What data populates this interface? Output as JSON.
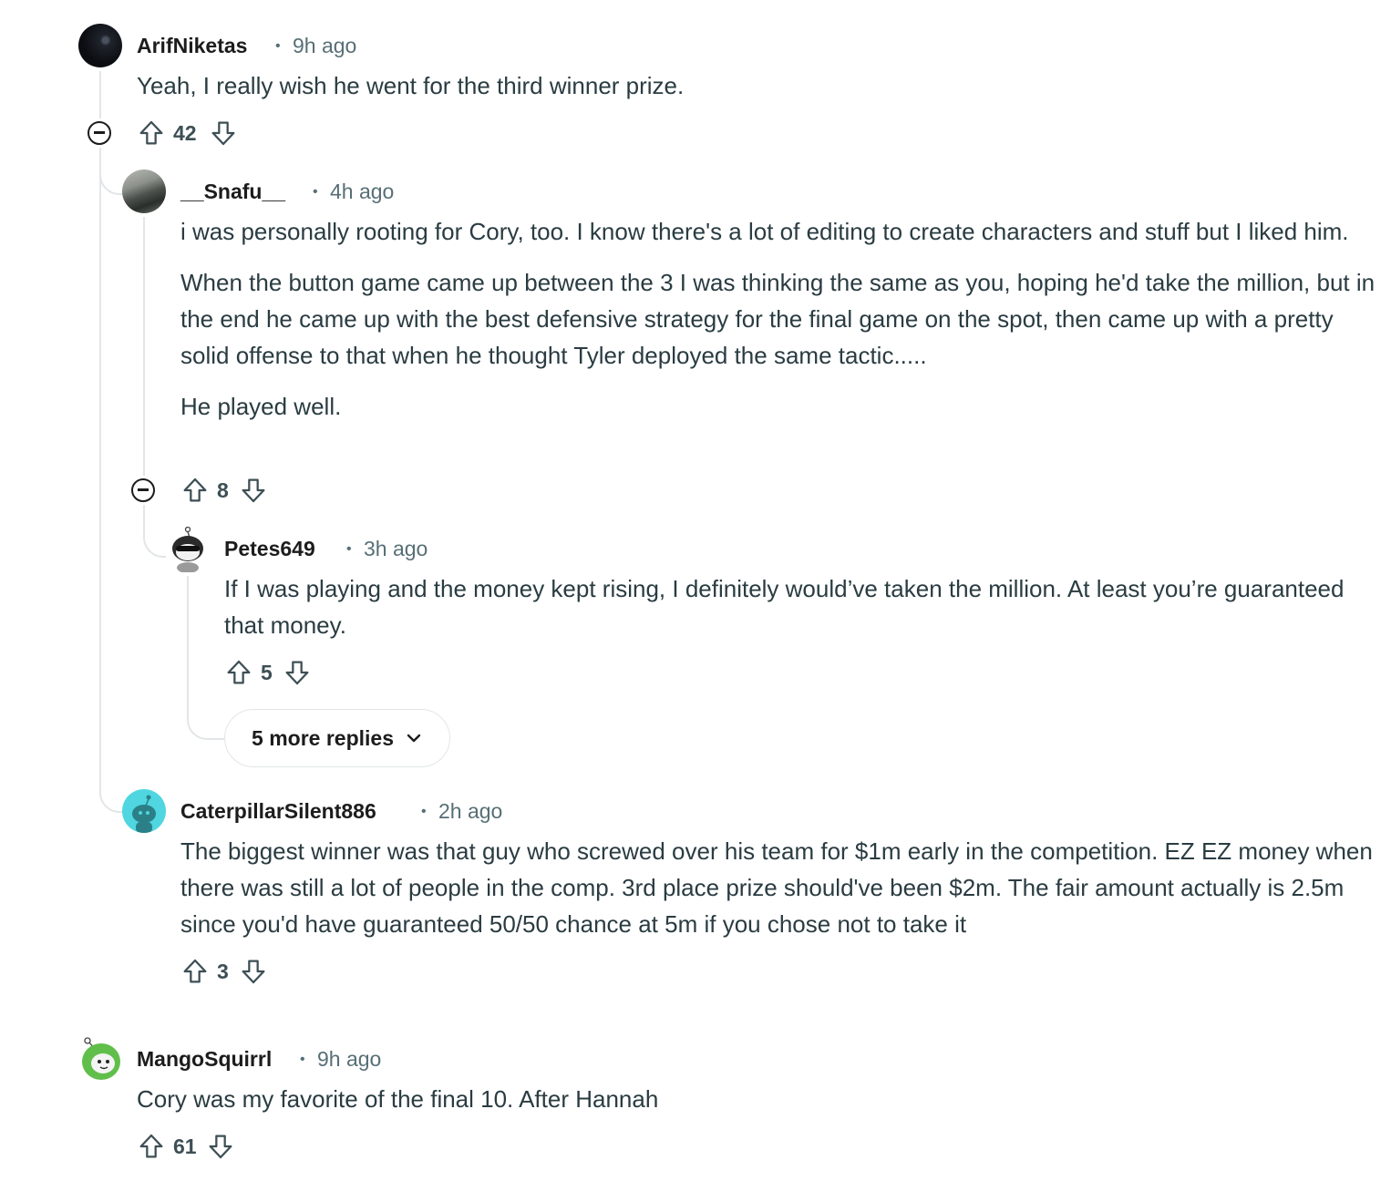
{
  "comments": [
    {
      "username": "ArifNiketas",
      "time": "9h ago",
      "body": [
        "Yeah, I really wish he went for the third winner prize."
      ],
      "score": "42"
    },
    {
      "username": "__Snafu__",
      "time": "4h ago",
      "body": [
        "i was personally rooting for Cory, too. I know there's a lot of editing to create characters and stuff but I liked him.",
        "When the button game came up between the 3 I was thinking the same as you, hoping he'd take the million, but in the end he came up with the best defensive strategy for the final game on the spot, then came up with a pretty solid offense to that when he thought Tyler deployed the same tactic.....",
        "He played well."
      ],
      "score": "8"
    },
    {
      "username": "Petes649",
      "time": "3h ago",
      "body": [
        "If I was playing and the money kept rising, I definitely would’ve taken the million. At least you’re guaranteed that money."
      ],
      "score": "5",
      "more_replies_label": "5 more replies"
    },
    {
      "username": "CaterpillarSilent886",
      "time": "2h ago",
      "body": [
        "The biggest winner was that guy who screwed over his team for $1m early in the competition. EZ EZ money when there was still a lot of people in the comp. 3rd place prize should've been $2m. The fair amount actually is 2.5m since you'd have guaranteed 50/50 chance at 5m if you chose not to take it"
      ],
      "score": "3"
    },
    {
      "username": "MangoSquirrl",
      "time": "9h ago",
      "body": [
        "Cory was my favorite of the final 10. After Hannah"
      ],
      "score": "61"
    }
  ],
  "separator": "•",
  "icons": {
    "upvote": "arrow-up-outline-icon",
    "downvote": "arrow-down-outline-icon",
    "collapse": "collapse-minus-icon",
    "chevron": "chevron-down-icon"
  },
  "colors": {
    "text": "#1c1c1c",
    "meta": "#576f76",
    "thread_line": "#e2e6e8",
    "caterpillar_avatar": "#4fd6e0"
  }
}
